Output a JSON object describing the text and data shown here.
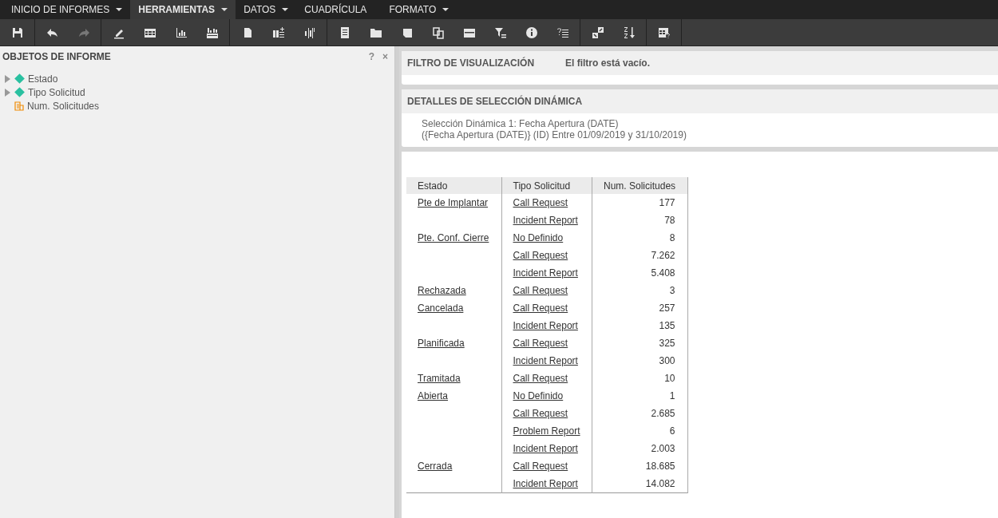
{
  "menu": [
    {
      "label": "INICIO DE INFORMES",
      "selected": false,
      "dropdown": true
    },
    {
      "label": "HERRAMIENTAS",
      "selected": true,
      "dropdown": true
    },
    {
      "label": "DATOS",
      "selected": false,
      "dropdown": true
    },
    {
      "label": "CUADRÍCULA",
      "selected": false,
      "dropdown": false
    },
    {
      "label": "FORMATO",
      "selected": false,
      "dropdown": true
    }
  ],
  "toolbar": [
    [
      {
        "kind": "save",
        "disabled": false
      }
    ],
    [
      {
        "kind": "undo",
        "disabled": false
      },
      {
        "kind": "redo",
        "disabled": true
      }
    ],
    [
      {
        "kind": "pencil",
        "disabled": false
      },
      {
        "kind": "table",
        "disabled": false
      },
      {
        "kind": "chart",
        "disabled": false
      },
      {
        "kind": "grid",
        "disabled": false
      }
    ],
    [
      {
        "kind": "page",
        "disabled": false
      },
      {
        "kind": "addrows",
        "disabled": false
      },
      {
        "kind": "addcols",
        "disabled": false
      }
    ],
    [
      {
        "kind": "doc",
        "disabled": false
      },
      {
        "kind": "folder",
        "disabled": false
      },
      {
        "kind": "note",
        "disabled": false
      },
      {
        "kind": "copy",
        "disabled": false
      },
      {
        "kind": "panel",
        "disabled": false
      },
      {
        "kind": "filter",
        "disabled": false
      },
      {
        "kind": "info",
        "disabled": false
      },
      {
        "kind": "help",
        "disabled": false
      }
    ],
    [
      {
        "kind": "swap",
        "disabled": false
      },
      {
        "kind": "sort",
        "disabled": false
      }
    ],
    [
      {
        "kind": "tablehelp",
        "disabled": false
      }
    ]
  ],
  "sidebar": {
    "title": "OBJETOS DE INFORME",
    "help": "?",
    "close": "×",
    "items": [
      {
        "label": "Estado",
        "kind": "attribute",
        "expanded": false
      },
      {
        "label": "Tipo Solicitud",
        "kind": "attribute",
        "expanded": false
      },
      {
        "label": "Num. Solicitudes",
        "kind": "metric"
      }
    ]
  },
  "filter": {
    "title": "FILTRO DE VISUALIZACIÓN",
    "status": "El filtro está vacío."
  },
  "selection": {
    "title": "DETALLES DE SELECCIÓN DINÁMICA",
    "lines": [
      "Selección Dinámica 1: Fecha Apertura (DATE)",
      "({Fecha Apertura (DATE)} (ID) Entre 01/09/2019 y 31/10/2019)"
    ]
  },
  "table": {
    "columns": [
      "Estado",
      "Tipo Solicitud",
      "Num. Solicitudes"
    ],
    "rows": [
      [
        "Pte de Implantar",
        "Call Request",
        "177"
      ],
      [
        "",
        "Incident Report",
        "78"
      ],
      [
        "Pte. Conf. Cierre",
        "No Definido",
        "8"
      ],
      [
        "",
        "Call Request",
        "7.262"
      ],
      [
        "",
        "Incident Report",
        "5.408"
      ],
      [
        "Rechazada",
        "Call Request",
        "3"
      ],
      [
        "Cancelada",
        "Call Request",
        "257"
      ],
      [
        "",
        "Incident Report",
        "135"
      ],
      [
        "Planificada",
        "Call Request",
        "325"
      ],
      [
        "",
        "Incident Report",
        "300"
      ],
      [
        "Tramitada",
        "Call Request",
        "10"
      ],
      [
        "Abierta",
        "No Definido",
        "1"
      ],
      [
        "",
        "Call Request",
        "2.685"
      ],
      [
        "",
        "Problem Report",
        "6"
      ],
      [
        "",
        "Incident Report",
        "2.003"
      ],
      [
        "Cerrada",
        "Call Request",
        "18.685"
      ],
      [
        "",
        "Incident Report",
        "14.082"
      ]
    ]
  }
}
